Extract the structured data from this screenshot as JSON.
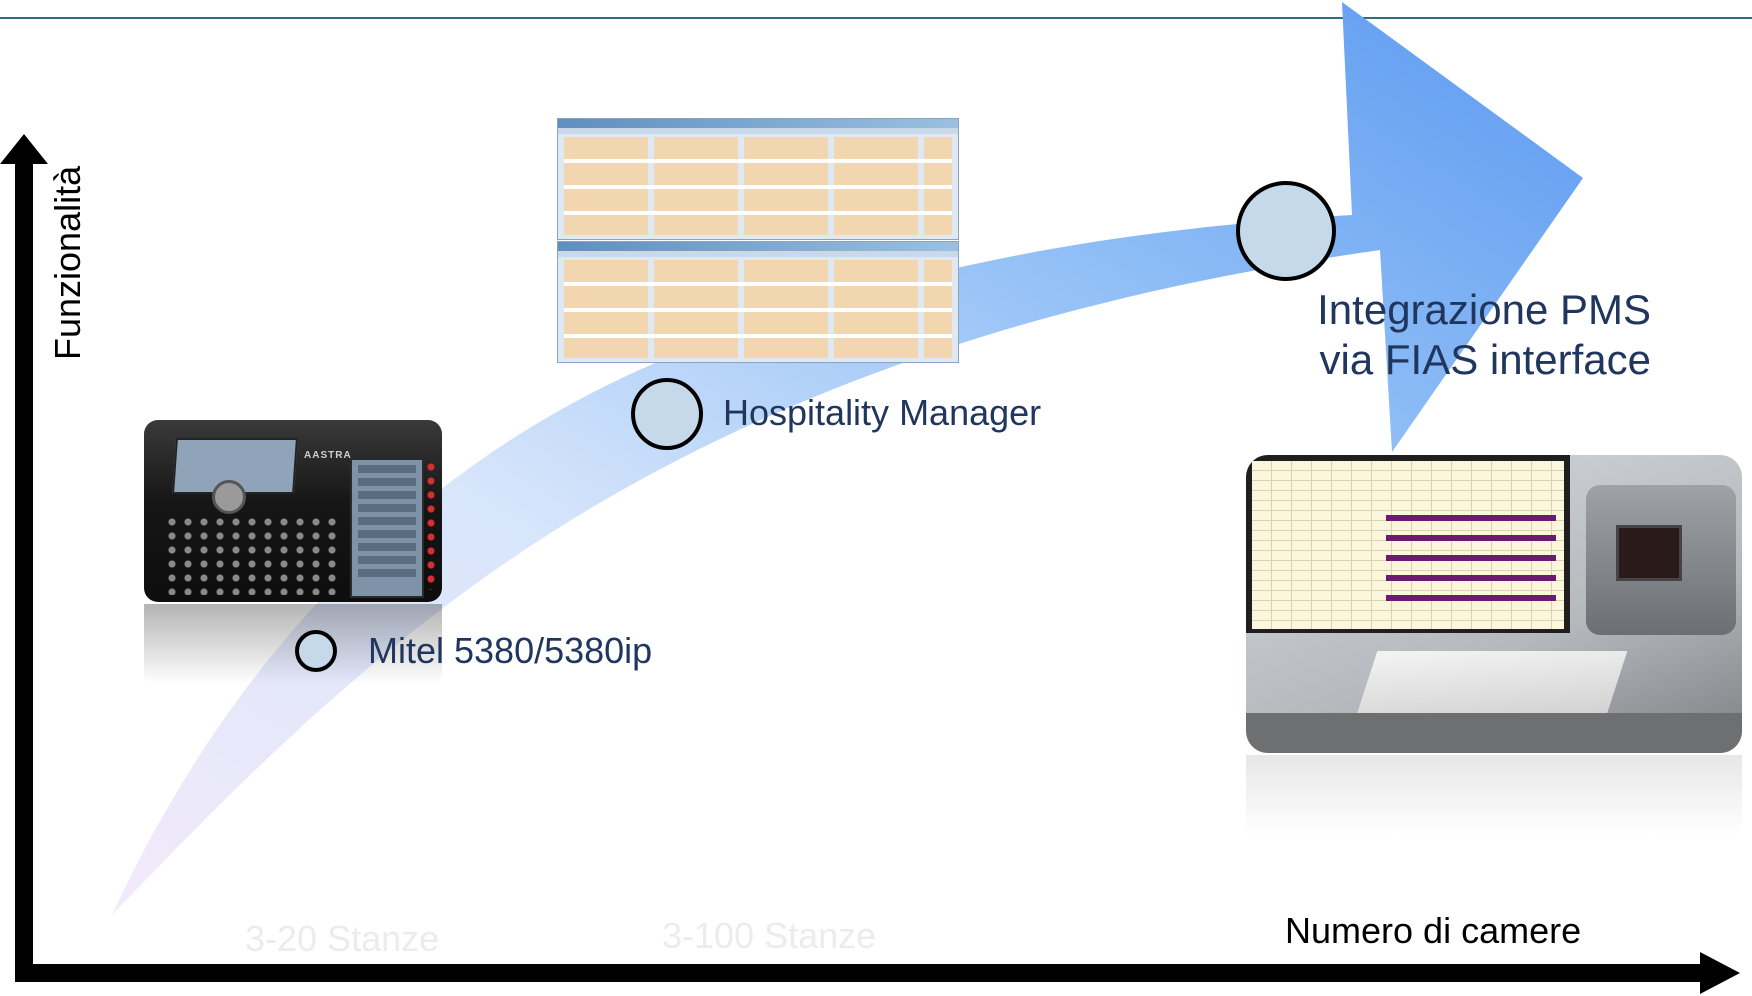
{
  "axes": {
    "y_label": "Funzionalità",
    "x_label": "Numero di camere"
  },
  "ranges": [
    "3-20 Stanze",
    "3-100 Stanze"
  ],
  "milestones": [
    {
      "label": "Mitel 5380/5380ip",
      "image": "desk-phone-photo"
    },
    {
      "label": "Hospitality Manager",
      "image": "hospitality-manager-screenshot"
    },
    {
      "label_lines": [
        "Integrazione  PMS",
        "via FIAS interface"
      ],
      "image": "pms-workstation-photo"
    }
  ],
  "colors": {
    "arrow_start": "#f3eafa",
    "arrow_end": "#5a98f0",
    "marker_fill": "#c5d9ea",
    "label_text": "#20365f",
    "top_rule": "#2e6e83"
  }
}
